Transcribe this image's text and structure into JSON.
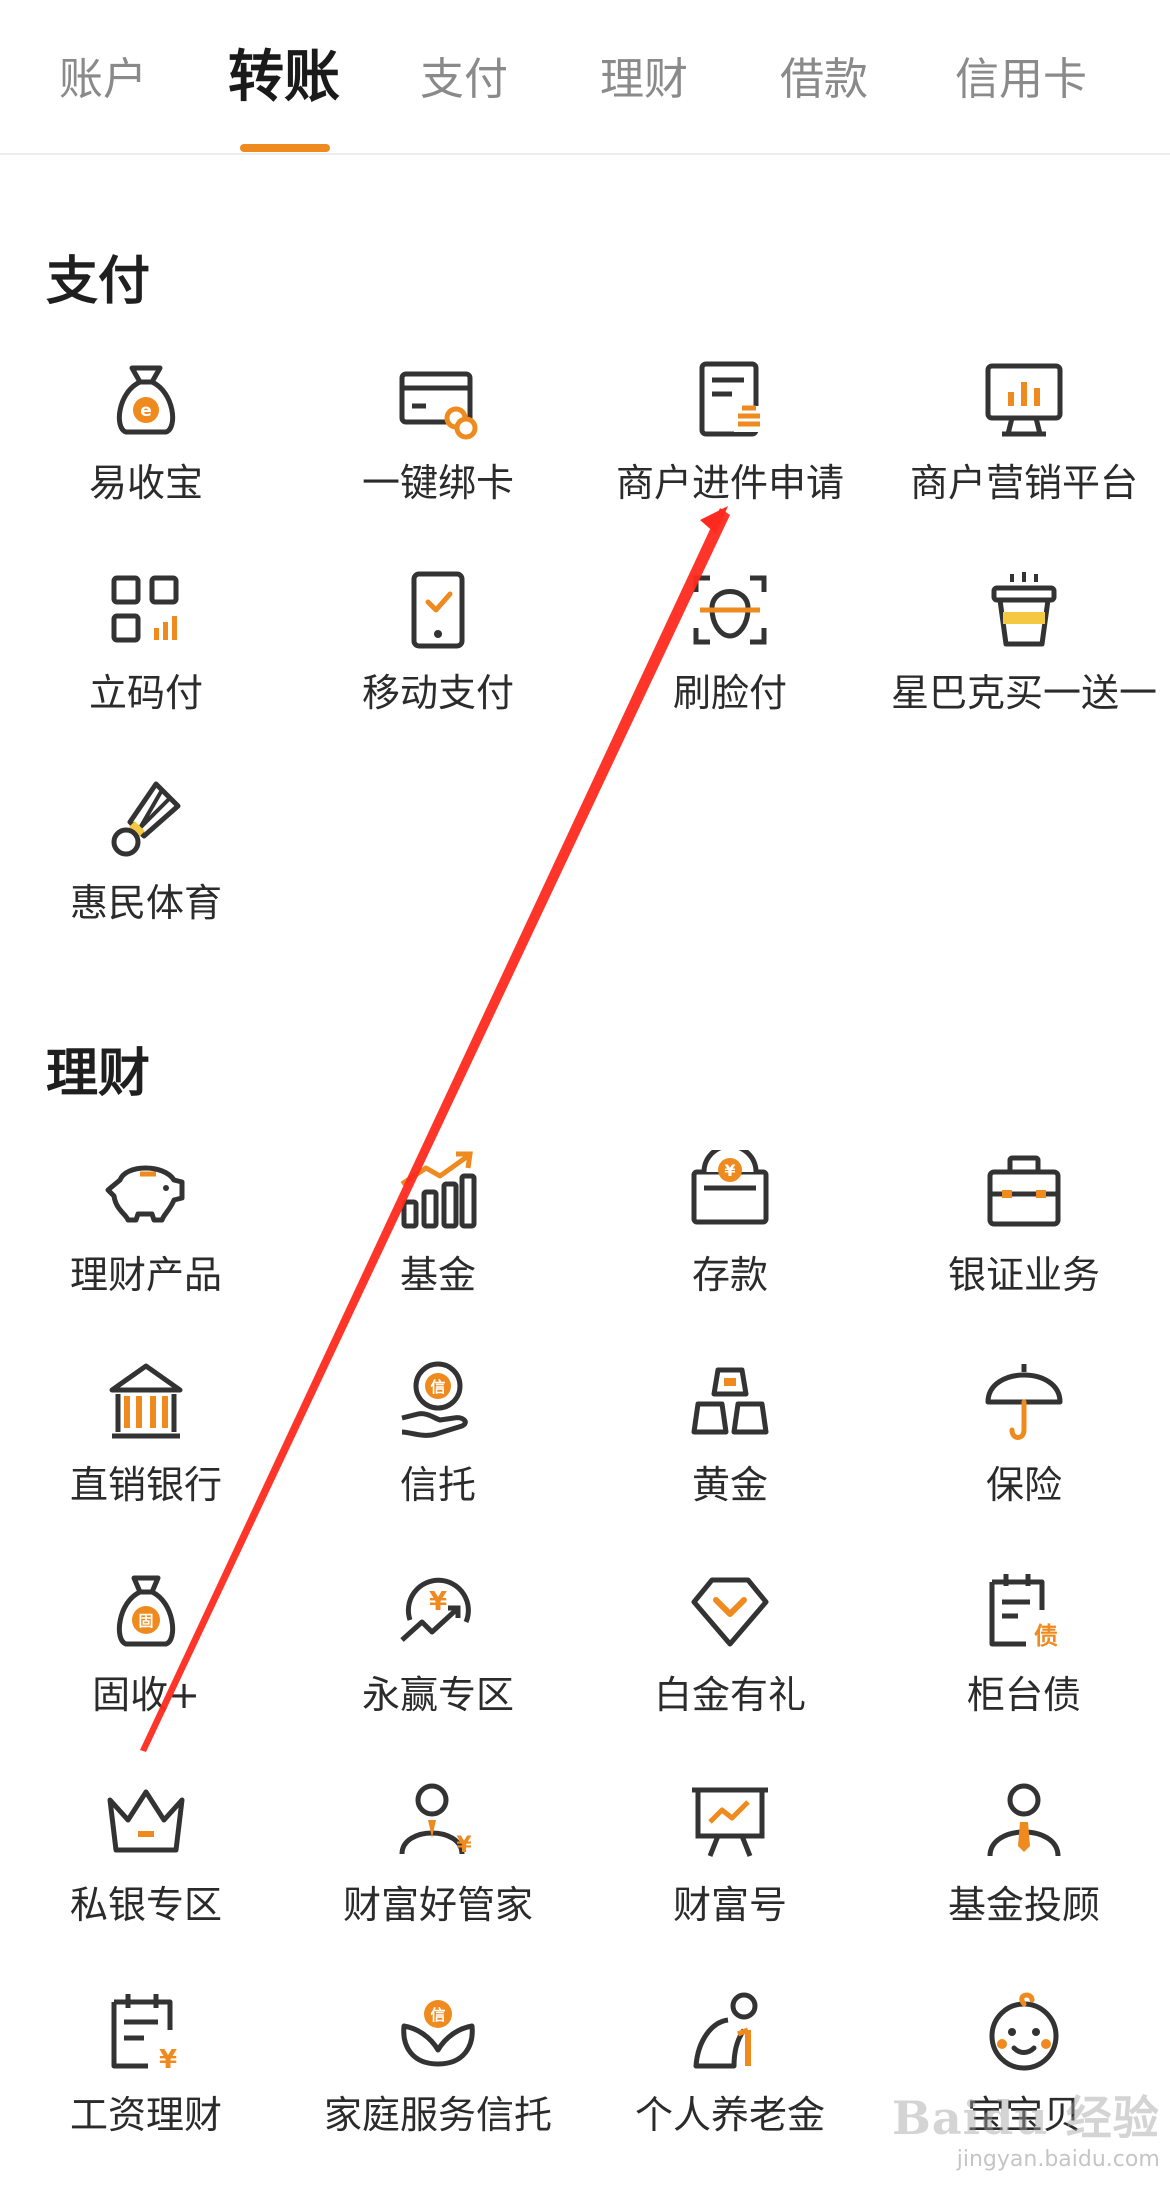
{
  "tabs": [
    {
      "label": "账户"
    },
    {
      "label": "转账"
    },
    {
      "label": "支付"
    },
    {
      "label": "理财"
    },
    {
      "label": "借款"
    },
    {
      "label": "信用卡"
    }
  ],
  "sections": {
    "pay": {
      "title": "支付",
      "items": [
        {
          "label": "易收宝",
          "icon": "money-bag-e-icon"
        },
        {
          "label": "一键绑卡",
          "icon": "card-link-icon"
        },
        {
          "label": "商户进件申请",
          "icon": "merchant-form-icon"
        },
        {
          "label": "商户营销平台",
          "icon": "marketing-chart-icon"
        },
        {
          "label": "立码付",
          "icon": "qr-code-icon"
        },
        {
          "label": "移动支付",
          "icon": "mobile-pay-icon"
        },
        {
          "label": "刷脸付",
          "icon": "face-scan-icon"
        },
        {
          "label": "星巴克买一送一",
          "icon": "coffee-cup-icon"
        },
        {
          "label": "惠民体育",
          "icon": "shuttlecock-icon"
        }
      ]
    },
    "wealth": {
      "title": "理财",
      "items": [
        {
          "label": "理财产品",
          "icon": "piggy-bank-icon"
        },
        {
          "label": "基金",
          "icon": "fund-bars-icon"
        },
        {
          "label": "存款",
          "icon": "deposit-box-icon"
        },
        {
          "label": "银证业务",
          "icon": "briefcase-icon"
        },
        {
          "label": "直销银行",
          "icon": "bank-building-icon"
        },
        {
          "label": "信托",
          "icon": "trust-hand-icon"
        },
        {
          "label": "黄金",
          "icon": "gold-bars-icon"
        },
        {
          "label": "保险",
          "icon": "umbrella-icon"
        },
        {
          "label": "固收+",
          "icon": "fixed-income-bag-icon"
        },
        {
          "label": "永赢专区",
          "icon": "yen-cycle-icon"
        },
        {
          "label": "白金有礼",
          "icon": "diamond-icon"
        },
        {
          "label": "柜台债",
          "icon": "bond-document-icon"
        },
        {
          "label": "私银专区",
          "icon": "crown-icon"
        },
        {
          "label": "财富好管家",
          "icon": "wealth-manager-icon"
        },
        {
          "label": "财富号",
          "icon": "presentation-board-icon"
        },
        {
          "label": "基金投顾",
          "icon": "advisor-icon"
        },
        {
          "label": "工资理财",
          "icon": "salary-calendar-icon"
        },
        {
          "label": "家庭服务信托",
          "icon": "family-trust-icon"
        },
        {
          "label": "个人养老金",
          "icon": "pension-icon"
        },
        {
          "label": "宝宝贝",
          "icon": "baby-face-icon"
        }
      ]
    }
  },
  "watermark": {
    "main": "Baidu 经验",
    "sub": "jingyan.baidu.com"
  },
  "colors": {
    "accent": "#ef8a1f",
    "icon_dark": "#333333",
    "arrow": "#ff2a1f"
  }
}
